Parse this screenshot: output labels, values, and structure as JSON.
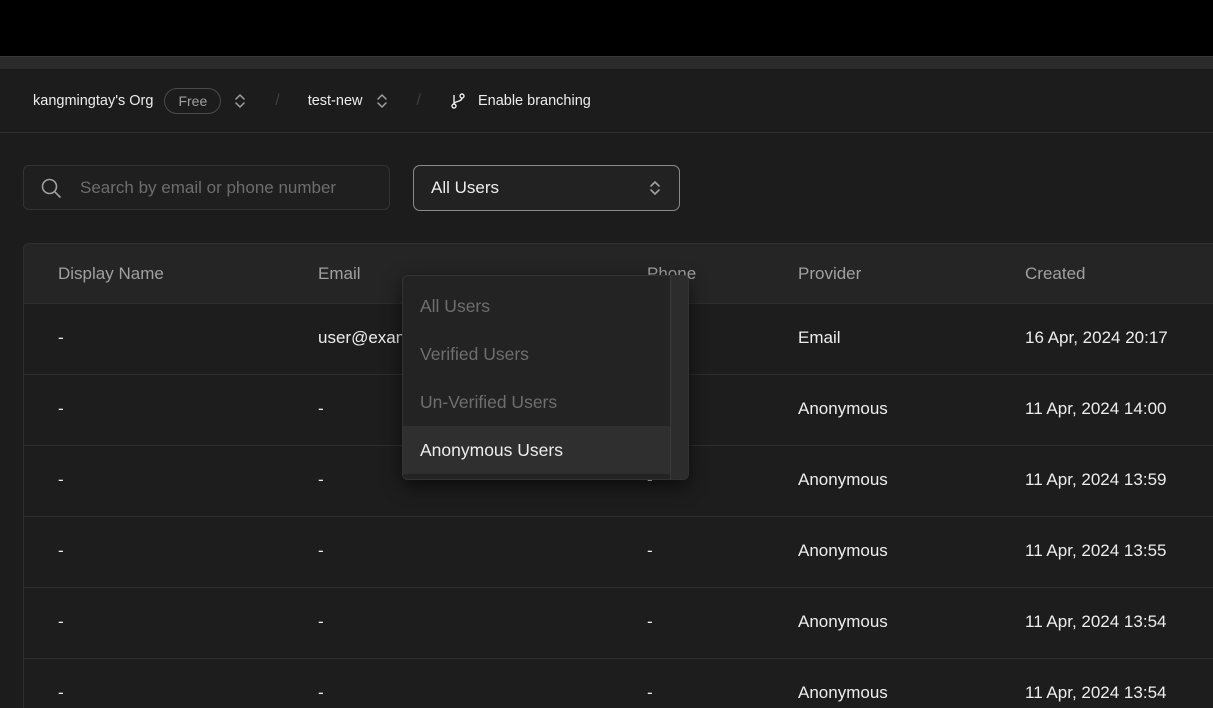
{
  "header": {
    "org_name": "kangmingtay's Org",
    "plan_badge": "Free",
    "separator": "/",
    "project_name": "test-new",
    "branching_label": "Enable branching"
  },
  "search": {
    "placeholder": "Search by email or phone number",
    "value": ""
  },
  "filter": {
    "selected": "All Users",
    "options": [
      "All Users",
      "Verified Users",
      "Un-Verified Users",
      "Anonymous Users"
    ],
    "highlighted_index": 3
  },
  "table": {
    "columns": [
      "Display Name",
      "Email",
      "Phone",
      "Provider",
      "Created"
    ],
    "rows": [
      {
        "display_name": "-",
        "email": "user@example.com",
        "phone": "-",
        "provider": "Email",
        "created": "16 Apr, 2024 20:17"
      },
      {
        "display_name": "-",
        "email": "-",
        "phone": "-",
        "provider": "Anonymous",
        "created": "11 Apr, 2024 14:00"
      },
      {
        "display_name": "-",
        "email": "-",
        "phone": "-",
        "provider": "Anonymous",
        "created": "11 Apr, 2024 13:59"
      },
      {
        "display_name": "-",
        "email": "-",
        "phone": "-",
        "provider": "Anonymous",
        "created": "11 Apr, 2024 13:55"
      },
      {
        "display_name": "-",
        "email": "-",
        "phone": "-",
        "provider": "Anonymous",
        "created": "11 Apr, 2024 13:54"
      },
      {
        "display_name": "-",
        "email": "-",
        "phone": "-",
        "provider": "Anonymous",
        "created": "11 Apr, 2024 13:54"
      }
    ]
  },
  "icons": {
    "search": "search-icon",
    "org_switch": "chevron-up-down-icon",
    "project_switch": "chevron-up-down-icon",
    "branch": "git-branch-icon",
    "select": "chevron-up-down-icon"
  },
  "colors": {
    "background": "#1c1c1c",
    "header_row": "#252525",
    "text": "#ededed",
    "muted_text": "#a0a0a0",
    "menu_highlight": "#2f2f2f"
  }
}
